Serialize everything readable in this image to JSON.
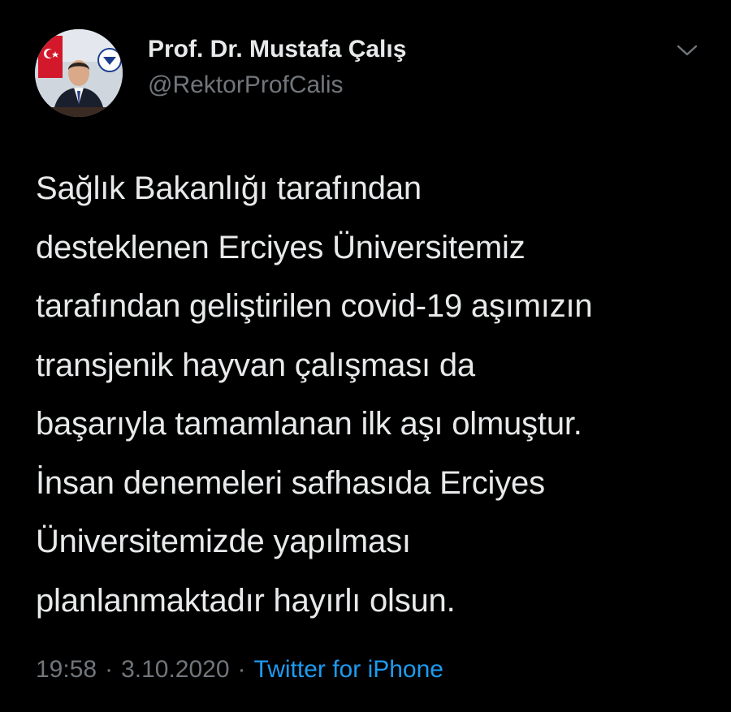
{
  "author": {
    "name": "Prof. Dr. Mustafa Çalış",
    "handle": "@RektorProfCalis",
    "avatar_icon": "profile-photo"
  },
  "tweet": {
    "lines": [
      "Sağlık Bakanlığı tarafından",
      "desteklenen Erciyes Üniversitemiz",
      "tarafından geliştirilen covid-19 aşımızın",
      "transjenik hayvan çalışması da",
      "başarıyla tamamlanan ilk aşı olmuştur.",
      "İnsan denemeleri safhasıda Erciyes",
      "Üniversitemizde yapılması",
      "planlanmaktadır hayırlı olsun."
    ]
  },
  "meta": {
    "time": "19:58",
    "separator": "·",
    "date": "3.10.2020",
    "source": "Twitter for iPhone"
  },
  "menu": {
    "icon": "chevron-down-icon"
  },
  "colors": {
    "background": "#000000",
    "text": "#e7e9ea",
    "secondary": "#71767b",
    "link": "#1d9bf0"
  }
}
